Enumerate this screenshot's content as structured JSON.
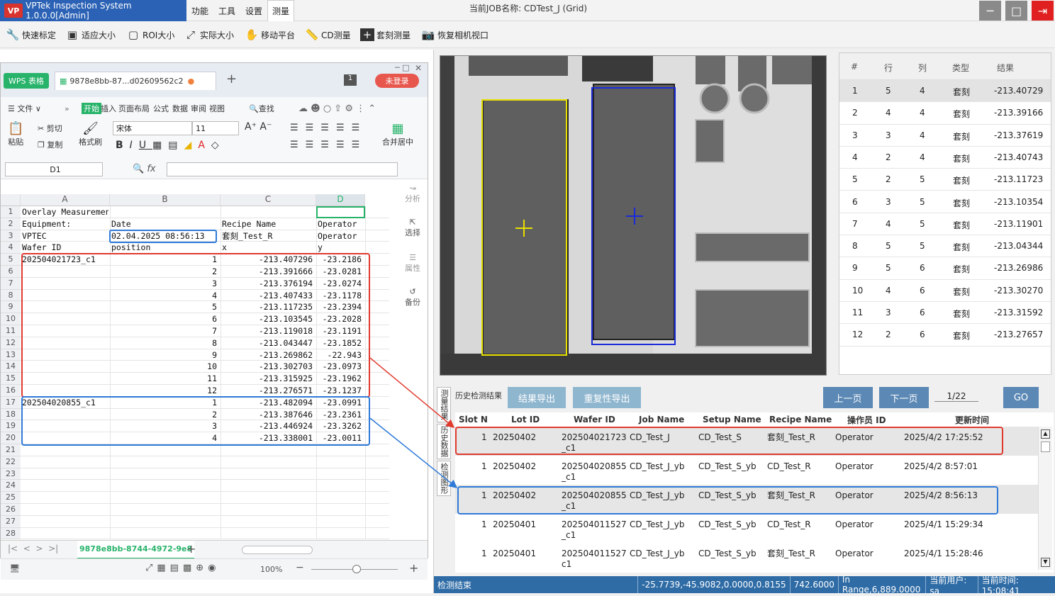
{
  "app": {
    "title": "VPTek Inspection System 1.0.0.0[Admin]",
    "logo_text": "VP",
    "menus": [
      "功能",
      "工具",
      "设置",
      "测量"
    ],
    "active_menu": "测量",
    "job_name": "当前JOB名称: CDTest_J (Grid)",
    "accent": "#2b62b5"
  },
  "toolbar": {
    "items": [
      {
        "label": "快速标定",
        "icon": "wrench-icon"
      },
      {
        "label": "适应大小",
        "icon": "fit-icon"
      },
      {
        "label": "ROI大小",
        "icon": "roi-icon"
      },
      {
        "label": "实际大小",
        "icon": "expand-icon"
      },
      {
        "label": "移动平台",
        "icon": "hand-icon"
      },
      {
        "label": "CD测量",
        "icon": "ruler-icon"
      },
      {
        "label": "套刻测量",
        "icon": "plus-icon"
      },
      {
        "label": "恢复相机视口",
        "icon": "camera-icon"
      }
    ]
  },
  "wps": {
    "badge": "WPS 表格",
    "tab_name": "9878e8bb-87...d02609562c2",
    "count_badge": "1",
    "login_label": "未登录",
    "ribbon_tabs": [
      "文件",
      "开始",
      "插入",
      "页面布局",
      "公式",
      "数据",
      "审阅",
      "视图"
    ],
    "search_label": "查找",
    "clipboard": {
      "paste": "粘贴",
      "cut": "剪切",
      "copy": "复制",
      "format": "格式刷"
    },
    "font_name": "宋体",
    "font_size": "11",
    "merge_label": "合并居中",
    "cell_ref": "D1",
    "fx": "fx",
    "columns": [
      "A",
      "B",
      "C",
      "D"
    ],
    "row_numbers": [
      "1",
      "2",
      "3",
      "4",
      "5",
      "6",
      "7",
      "8",
      "9",
      "10",
      "11",
      "12",
      "13",
      "14",
      "15",
      "16",
      "17",
      "18",
      "19",
      "20",
      "21",
      "22",
      "23",
      "24",
      "25",
      "26",
      "27",
      "28"
    ],
    "header_rows": [
      {
        "a": "Overlay Measurement",
        "b": "",
        "c": "",
        "d": ""
      },
      {
        "a": "Equipment:",
        "b": "Date",
        "c": "Recipe Name",
        "d": "Operator"
      },
      {
        "a": "VPTEC",
        "b": "02.04.2025 08:56:13",
        "c": "套刻_Test_R",
        "d": "Operator"
      },
      {
        "a": "Wafer ID",
        "b": "position",
        "c": "x",
        "d": "y"
      }
    ],
    "data_rows": [
      {
        "a": "202504021723_c1",
        "b": "1",
        "c": "-213.407296",
        "d": "-23.2186"
      },
      {
        "a": "",
        "b": "2",
        "c": "-213.391666",
        "d": "-23.0281"
      },
      {
        "a": "",
        "b": "3",
        "c": "-213.376194",
        "d": "-23.0274"
      },
      {
        "a": "",
        "b": "4",
        "c": "-213.407433",
        "d": "-23.1178"
      },
      {
        "a": "",
        "b": "5",
        "c": "-213.117235",
        "d": "-23.2394"
      },
      {
        "a": "",
        "b": "6",
        "c": "-213.103545",
        "d": "-23.2028"
      },
      {
        "a": "",
        "b": "7",
        "c": "-213.119018",
        "d": "-23.1191"
      },
      {
        "a": "",
        "b": "8",
        "c": "-213.043447",
        "d": "-23.1852"
      },
      {
        "a": "",
        "b": "9",
        "c": "-213.269862",
        "d": "-22.943"
      },
      {
        "a": "",
        "b": "10",
        "c": "-213.302703",
        "d": "-23.0973"
      },
      {
        "a": "",
        "b": "11",
        "c": "-213.315925",
        "d": "-23.1962"
      },
      {
        "a": "",
        "b": "12",
        "c": "-213.276571",
        "d": "-23.1237"
      },
      {
        "a": "202504020855_c1",
        "b": "1",
        "c": "-213.482094",
        "d": "-23.0991"
      },
      {
        "a": "",
        "b": "2",
        "c": "-213.387646",
        "d": "-23.2361"
      },
      {
        "a": "",
        "b": "3",
        "c": "-213.446924",
        "d": "-23.3262"
      },
      {
        "a": "",
        "b": "4",
        "c": "-213.338001",
        "d": "-23.0011"
      }
    ],
    "sheet_tab": "9878e8bb-8744-4972-9e8",
    "zoom": "100%",
    "side_buttons": [
      "分析",
      "选择",
      "属性",
      "备份"
    ]
  },
  "results_table": {
    "headers": [
      "#",
      "行",
      "列",
      "类型",
      "结果"
    ],
    "rows": [
      [
        "1",
        "5",
        "4",
        "套刻",
        "-213.40729"
      ],
      [
        "2",
        "4",
        "4",
        "套刻",
        "-213.39166"
      ],
      [
        "3",
        "3",
        "4",
        "套刻",
        "-213.37619"
      ],
      [
        "4",
        "2",
        "4",
        "套刻",
        "-213.40743"
      ],
      [
        "5",
        "2",
        "5",
        "套刻",
        "-213.11723"
      ],
      [
        "6",
        "3",
        "5",
        "套刻",
        "-213.10354"
      ],
      [
        "7",
        "4",
        "5",
        "套刻",
        "-213.11901"
      ],
      [
        "8",
        "5",
        "5",
        "套刻",
        "-213.04344"
      ],
      [
        "9",
        "5",
        "6",
        "套刻",
        "-213.26986"
      ],
      [
        "10",
        "4",
        "6",
        "套刻",
        "-213.30270"
      ],
      [
        "11",
        "3",
        "6",
        "套刻",
        "-213.31592"
      ],
      [
        "12",
        "2",
        "6",
        "套刻",
        "-213.27657"
      ]
    ]
  },
  "history": {
    "title": "历史检测结果",
    "export_results": "结果导出",
    "export_repeat": "重复性导出",
    "prev": "上一页",
    "next": "下一页",
    "page": "1/22",
    "go": "GO",
    "vertical_tabs": [
      "测量结果",
      "历史数据",
      "检测图形"
    ],
    "headers": [
      "Slot N",
      "Lot ID",
      "Wafer ID",
      "Job Name",
      "Setup Name",
      "Recipe Name",
      "操作员 ID",
      "更新时间"
    ],
    "rows": [
      {
        "slot": "1",
        "lot": "20250402",
        "wafer": "202504021723",
        "wafer2": "_c1",
        "job": "CD_Test_J",
        "setup": "CD_Test_S",
        "recipe": "套刻_Test_R",
        "op": "Operator",
        "time": "2025/4/2 17:25:52"
      },
      {
        "slot": "1",
        "lot": "20250402",
        "wafer": "202504020855",
        "wafer2": "_c1",
        "job": "CD_Test_J_yb",
        "setup": "CD_Test_S_yb",
        "recipe": "CD_Test_R",
        "op": "Operator",
        "time": "2025/4/2 8:57:01"
      },
      {
        "slot": "1",
        "lot": "20250402",
        "wafer": "202504020855",
        "wafer2": "_c1",
        "job": "CD_Test_J_yb",
        "setup": "CD_Test_S_yb",
        "recipe": "套刻_Test_R",
        "op": "Operator",
        "time": "2025/4/2 8:56:13"
      },
      {
        "slot": "1",
        "lot": "20250401",
        "wafer": "202504011527",
        "wafer2": "_c1",
        "job": "CD_Test_J_yb",
        "setup": "CD_Test_S_yb",
        "recipe": "CD_Test_R",
        "op": "Operator",
        "time": "2025/4/1 15:29:34"
      },
      {
        "slot": "1",
        "lot": "20250401",
        "wafer": "202504011527",
        "wafer2": "c1",
        "job": "CD_Test_J_yb",
        "setup": "CD_Test_S_yb",
        "recipe": "套刻_Test_R",
        "op": "Operator",
        "time": "2025/4/1 15:28:46"
      }
    ]
  },
  "status": {
    "left": "检测结束",
    "coords": "-25.7739,-45.9082,0.0000,0.8155",
    "value": "742.6000",
    "range": "In Range,6,889.0000",
    "user": "当前用户: sa",
    "time": "当前时间: 15:08:41"
  },
  "colors": {
    "red_box": "#e03a2e",
    "blue_box": "#2f7ad8",
    "yellow_roi": "#e8e000",
    "blue_roi": "#1a2ad8"
  }
}
